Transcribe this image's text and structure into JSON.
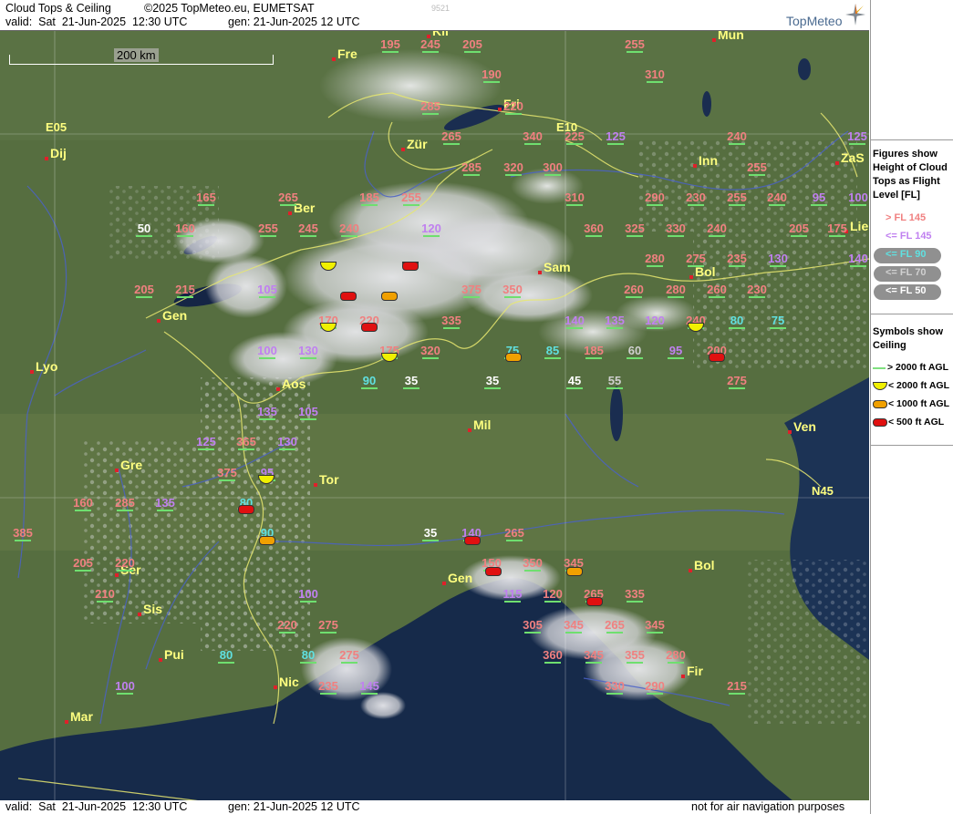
{
  "header": {
    "title": "Cloud Tops & Ceiling",
    "copyright": "©2025 TopMeteo.eu, EUMETSAT",
    "code": "9521",
    "valid": "valid:  Sat  21-Jun-2025  12:30 UTC",
    "gen": "gen: 21-Jun-2025 12 UTC",
    "brand": "TopMeteo"
  },
  "footer": {
    "valid": "valid:  Sat  21-Jun-2025  12:30 UTC",
    "gen": "gen: 21-Jun-2025 12 UTC",
    "note": "not for air navigation purposes"
  },
  "scale": {
    "label": "200 km"
  },
  "grid_labels": {
    "e05": "E05",
    "e10": "E10",
    "n45": "N45"
  },
  "legend": {
    "figures_title": "Figures show Height of Cloud Tops as Flight Level  [FL]",
    "levels": [
      {
        "label": "> FL 145",
        "color": "#f08080"
      },
      {
        "label": "<= FL 145",
        "color": "#c080f0"
      },
      {
        "label": "<= FL 90",
        "color": "#60e0e0"
      },
      {
        "label": "<= FL 70",
        "color": "#d0d0d0"
      },
      {
        "label": "<= FL 50",
        "color": "#ffffff"
      }
    ],
    "symbols_title": "Symbols show Ceiling",
    "symbols": [
      {
        "label": "> 2000 ft AGL",
        "color": "#80e080"
      },
      {
        "label": "< 2000 ft AGL",
        "color": "#f0f000"
      },
      {
        "label": "< 1000 ft AGL",
        "color": "#f0a000"
      },
      {
        "label": "< 500 ft AGL",
        "color": "#e01010"
      }
    ]
  },
  "cities": [
    {
      "name": "Fre"
    },
    {
      "name": "Kli"
    },
    {
      "name": "Mun"
    },
    {
      "name": "Dij"
    },
    {
      "name": "Zür"
    },
    {
      "name": "Fri"
    },
    {
      "name": "Inn"
    },
    {
      "name": "ZaS"
    },
    {
      "name": "Ber"
    },
    {
      "name": "Lie"
    },
    {
      "name": "Sam"
    },
    {
      "name": "Bol"
    },
    {
      "name": "Gen"
    },
    {
      "name": "Lyo"
    },
    {
      "name": "Aos"
    },
    {
      "name": "Mil"
    },
    {
      "name": "Ven"
    },
    {
      "name": "Gre"
    },
    {
      "name": "Tor"
    },
    {
      "name": "Ser"
    },
    {
      "name": "Gen"
    },
    {
      "name": "Bol"
    },
    {
      "name": "Sis"
    },
    {
      "name": "Pui"
    },
    {
      "name": "Nic"
    },
    {
      "name": "Mar"
    },
    {
      "name": "Fir"
    }
  ],
  "cloud_tops": [
    {
      "v": "195",
      "c": "#f08080"
    },
    {
      "v": "245",
      "c": "#f08080"
    },
    {
      "v": "205",
      "c": "#f08080"
    },
    {
      "v": "255",
      "c": "#f08080"
    },
    {
      "v": "190",
      "c": "#f08080"
    },
    {
      "v": "310",
      "c": "#f08080"
    },
    {
      "v": "285",
      "c": "#f08080"
    },
    {
      "v": "220",
      "c": "#f08080"
    },
    {
      "v": "265",
      "c": "#f08080"
    },
    {
      "v": "340",
      "c": "#f08080"
    },
    {
      "v": "225",
      "c": "#f08080"
    },
    {
      "v": "125",
      "c": "#c080f0"
    },
    {
      "v": "240",
      "c": "#f08080"
    },
    {
      "v": "125",
      "c": "#c080f0"
    },
    {
      "v": "285",
      "c": "#f08080"
    },
    {
      "v": "320",
      "c": "#f08080"
    },
    {
      "v": "300",
      "c": "#f08080"
    },
    {
      "v": "255",
      "c": "#f08080"
    },
    {
      "v": "165",
      "c": "#f08080"
    },
    {
      "v": "265",
      "c": "#f08080"
    },
    {
      "v": "185",
      "c": "#f08080"
    },
    {
      "v": "255",
      "c": "#f08080"
    },
    {
      "v": "310",
      "c": "#f08080"
    },
    {
      "v": "290",
      "c": "#f08080"
    },
    {
      "v": "230",
      "c": "#f08080"
    },
    {
      "v": "255",
      "c": "#f08080"
    },
    {
      "v": "240",
      "c": "#f08080"
    },
    {
      "v": "95",
      "c": "#c080f0"
    },
    {
      "v": "100",
      "c": "#c080f0"
    },
    {
      "v": "50",
      "c": "#ffffff"
    },
    {
      "v": "255",
      "c": "#f08080"
    },
    {
      "v": "245",
      "c": "#f08080"
    },
    {
      "v": "360",
      "c": "#f08080"
    },
    {
      "v": "325",
      "c": "#f08080"
    },
    {
      "v": "330",
      "c": "#f08080"
    },
    {
      "v": "240",
      "c": "#f08080"
    },
    {
      "v": "205",
      "c": "#f08080"
    },
    {
      "v": "175",
      "c": "#f08080"
    },
    {
      "v": "160",
      "c": "#f08080"
    },
    {
      "v": "280",
      "c": "#f08080"
    },
    {
      "v": "275",
      "c": "#f08080"
    },
    {
      "v": "235",
      "c": "#f08080"
    },
    {
      "v": "130",
      "c": "#c080f0"
    },
    {
      "v": "140",
      "c": "#c080f0"
    },
    {
      "v": "205",
      "c": "#f08080"
    },
    {
      "v": "215",
      "c": "#f08080"
    },
    {
      "v": "105",
      "c": "#c080f0"
    },
    {
      "v": "350",
      "c": "#f08080"
    },
    {
      "v": "260",
      "c": "#f08080"
    },
    {
      "v": "280",
      "c": "#f08080"
    },
    {
      "v": "260",
      "c": "#f08080"
    },
    {
      "v": "230",
      "c": "#f08080"
    },
    {
      "v": "375",
      "c": "#f08080"
    },
    {
      "v": "170",
      "c": "#f08080"
    },
    {
      "v": "220",
      "c": "#f08080"
    },
    {
      "v": "335",
      "c": "#f08080"
    },
    {
      "v": "140",
      "c": "#c080f0"
    },
    {
      "v": "135",
      "c": "#c080f0"
    },
    {
      "v": "120",
      "c": "#c080f0"
    },
    {
      "v": "240",
      "c": "#f08080"
    },
    {
      "v": "80",
      "c": "#60e0e0"
    },
    {
      "v": "75",
      "c": "#60e0e0"
    },
    {
      "v": "100",
      "c": "#c080f0"
    },
    {
      "v": "130",
      "c": "#c080f0"
    },
    {
      "v": "175",
      "c": "#f08080"
    },
    {
      "v": "320",
      "c": "#f08080"
    },
    {
      "v": "75",
      "c": "#60e0e0"
    },
    {
      "v": "85",
      "c": "#60e0e0"
    },
    {
      "v": "185",
      "c": "#f08080"
    },
    {
      "v": "60",
      "c": "#d0d0d0"
    },
    {
      "v": "95",
      "c": "#c080f0"
    },
    {
      "v": "200",
      "c": "#f08080"
    },
    {
      "v": "120",
      "c": "#c080f0"
    },
    {
      "v": "240",
      "c": "#f08080"
    },
    {
      "v": "90",
      "c": "#60e0e0"
    },
    {
      "v": "35",
      "c": "#ffffff"
    },
    {
      "v": "35",
      "c": "#ffffff"
    },
    {
      "v": "45",
      "c": "#ffffff"
    },
    {
      "v": "55",
      "c": "#d0d0d0"
    },
    {
      "v": "275",
      "c": "#f08080"
    },
    {
      "v": "135",
      "c": "#c080f0"
    },
    {
      "v": "105",
      "c": "#c080f0"
    },
    {
      "v": "125",
      "c": "#c080f0"
    },
    {
      "v": "365",
      "c": "#f08080"
    },
    {
      "v": "130",
      "c": "#c080f0"
    },
    {
      "v": "375",
      "c": "#f08080"
    },
    {
      "v": "95",
      "c": "#c080f0"
    },
    {
      "v": "160",
      "c": "#f08080"
    },
    {
      "v": "285",
      "c": "#f08080"
    },
    {
      "v": "135",
      "c": "#c080f0"
    },
    {
      "v": "80",
      "c": "#60e0e0"
    },
    {
      "v": "385",
      "c": "#f08080"
    },
    {
      "v": "90",
      "c": "#60e0e0"
    },
    {
      "v": "35",
      "c": "#ffffff"
    },
    {
      "v": "140",
      "c": "#c080f0"
    },
    {
      "v": "265",
      "c": "#f08080"
    },
    {
      "v": "205",
      "c": "#f08080"
    },
    {
      "v": "220",
      "c": "#f08080"
    },
    {
      "v": "150",
      "c": "#f08080"
    },
    {
      "v": "350",
      "c": "#f08080"
    },
    {
      "v": "345",
      "c": "#f08080"
    },
    {
      "v": "210",
      "c": "#f08080"
    },
    {
      "v": "100",
      "c": "#c080f0"
    },
    {
      "v": "115",
      "c": "#c080f0"
    },
    {
      "v": "120",
      "c": "#f08080"
    },
    {
      "v": "265",
      "c": "#f08080"
    },
    {
      "v": "335",
      "c": "#f08080"
    },
    {
      "v": "220",
      "c": "#f08080"
    },
    {
      "v": "275",
      "c": "#f08080"
    },
    {
      "v": "305",
      "c": "#f08080"
    },
    {
      "v": "345",
      "c": "#f08080"
    },
    {
      "v": "265",
      "c": "#f08080"
    },
    {
      "v": "345",
      "c": "#f08080"
    },
    {
      "v": "80",
      "c": "#60e0e0"
    },
    {
      "v": "80",
      "c": "#60e0e0"
    },
    {
      "v": "275",
      "c": "#f08080"
    },
    {
      "v": "360",
      "c": "#f08080"
    },
    {
      "v": "345",
      "c": "#f08080"
    },
    {
      "v": "355",
      "c": "#f08080"
    },
    {
      "v": "280",
      "c": "#f08080"
    },
    {
      "v": "100",
      "c": "#c080f0"
    },
    {
      "v": "235",
      "c": "#f08080"
    },
    {
      "v": "145",
      "c": "#c080f0"
    },
    {
      "v": "330",
      "c": "#f08080"
    },
    {
      "v": "290",
      "c": "#f08080"
    },
    {
      "v": "215",
      "c": "#f08080"
    }
  ],
  "ceiling_symbols": [
    {
      "t": "yellow"
    },
    {
      "t": "yellow"
    },
    {
      "t": "red"
    },
    {
      "t": "orange"
    },
    {
      "t": "yellow"
    },
    {
      "t": "red"
    },
    {
      "t": "yellow"
    },
    {
      "t": "yellow"
    },
    {
      "t": "orange"
    },
    {
      "t": "yellow"
    },
    {
      "t": "red"
    },
    {
      "t": "orange"
    },
    {
      "t": "red"
    },
    {
      "t": "orange"
    },
    {
      "t": "red"
    },
    {
      "t": "red"
    },
    {
      "t": "red"
    },
    {
      "t": "red"
    }
  ]
}
